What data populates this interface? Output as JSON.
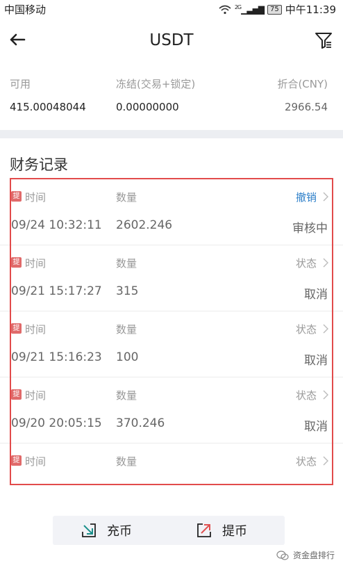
{
  "status_bar": {
    "carrier": "中国移动",
    "network": "2G",
    "battery": "75",
    "time": "中午11:39"
  },
  "header": {
    "title": "USDT"
  },
  "balance": {
    "available_label": "可用",
    "available_value": "415.00048044",
    "frozen_label": "冻结(交易+锁定)",
    "frozen_value": "0.00000000",
    "cny_label": "折合(CNY)",
    "cny_value": "2966.54"
  },
  "section_title": "财务记录",
  "records": [
    {
      "badge": "提",
      "time_label": "时间",
      "qty_label": "数量",
      "action_label": "撤销",
      "time": "09/24 10:32:11",
      "qty": "2602.246",
      "status": "审核中"
    },
    {
      "badge": "提",
      "time_label": "时间",
      "qty_label": "数量",
      "action_label": "状态",
      "time": "09/21 15:17:27",
      "qty": "315",
      "status": "取消"
    },
    {
      "badge": "提",
      "time_label": "时间",
      "qty_label": "数量",
      "action_label": "状态",
      "time": "09/21 15:16:23",
      "qty": "100",
      "status": "取消"
    },
    {
      "badge": "提",
      "time_label": "时间",
      "qty_label": "数量",
      "action_label": "状态",
      "time": "09/20 20:05:15",
      "qty": "370.246",
      "status": "取消"
    },
    {
      "badge": "提",
      "time_label": "时间",
      "qty_label": "数量",
      "action_label": "状态",
      "time": "",
      "qty": "",
      "status": ""
    }
  ],
  "actions": {
    "deposit_label": "充币",
    "withdraw_label": "提币"
  },
  "watermark": "资金盘排行",
  "colors": {
    "accent_link": "#2d7fc9",
    "highlight_border": "#e24b4b",
    "badge": "#e06a6a"
  }
}
